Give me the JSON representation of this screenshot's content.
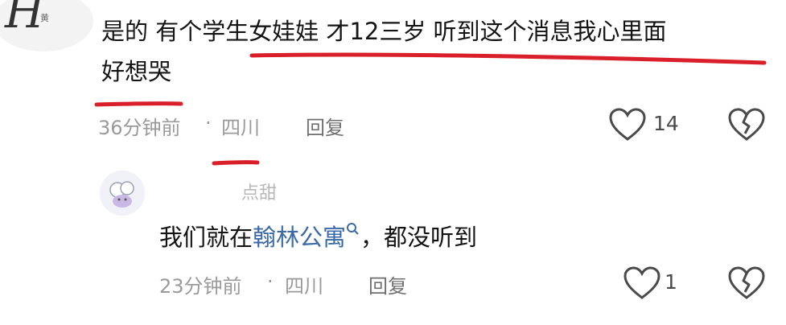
{
  "comment": {
    "avatar_text": "H",
    "avatar_sub": "黄",
    "text_line1": "是的 有个学生女娃娃 才12三岁 听到这个消息我心里面",
    "text_line2": "好想哭",
    "time": "36分钟前",
    "dot": "·",
    "location": "四川",
    "reply_label": "回复",
    "like_count": "14"
  },
  "reply": {
    "username": "点甜",
    "text_before": "我们就在",
    "link_text": "翰林公寓",
    "text_after": "，都没听到",
    "time": "23分钟前",
    "dot": "·",
    "location": "四川",
    "reply_label": "回复",
    "like_count": "1"
  },
  "colors": {
    "underline_red": "#d9202a",
    "link_blue": "#3b6aa7"
  }
}
